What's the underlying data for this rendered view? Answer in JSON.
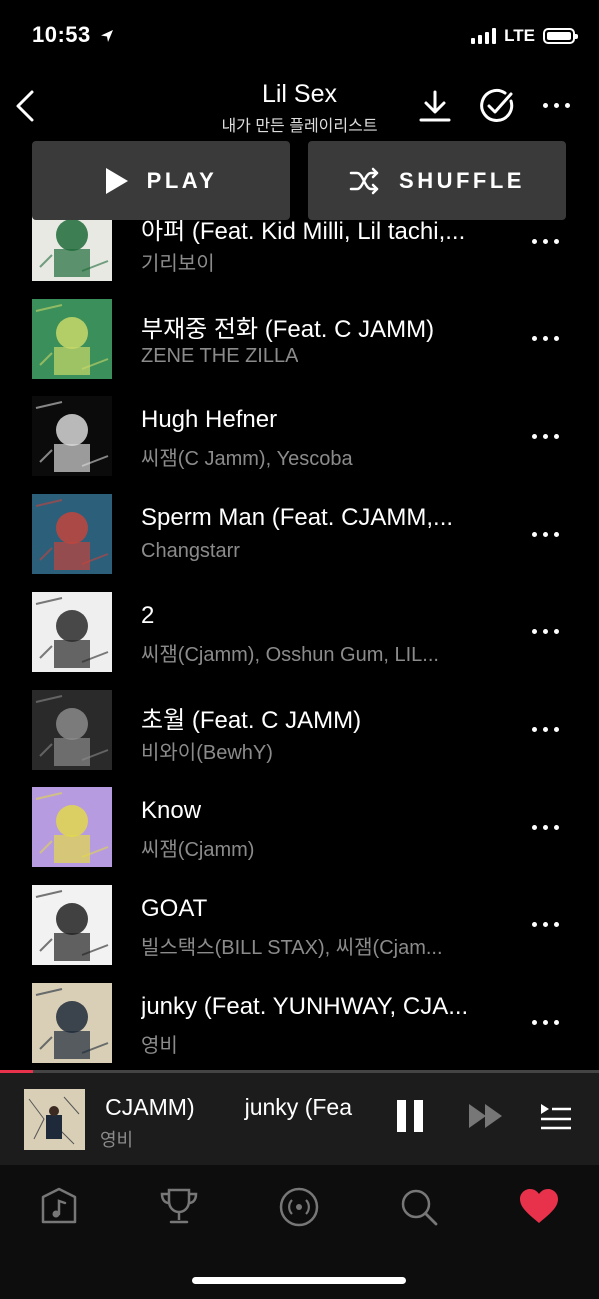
{
  "status": {
    "time": "10:53",
    "network": "LTE"
  },
  "header": {
    "title": "Lil Sex",
    "subtitle": "내가 만든 플레이리스트"
  },
  "actions": {
    "play_label": "PLAY",
    "shuffle_label": "SHUFFLE"
  },
  "tracks": [
    {
      "title": "아퍼 (Feat. Kid Milli, Lil tachi,...",
      "artist": "기리보이",
      "art_colors": [
        "#e9e9e3",
        "#1f6b3a"
      ]
    },
    {
      "title": "부재중 전화 (Feat. C JAMM)",
      "artist": "ZENE THE ZILLA",
      "art_colors": [
        "#3b8f5a",
        "#c9d86a"
      ]
    },
    {
      "title": "Hugh Hefner",
      "artist": "씨잼(C Jamm), Yescoba",
      "art_colors": [
        "#0b0b0b",
        "#d8d8d8"
      ]
    },
    {
      "title": "Sperm Man (Feat. CJAMM,...",
      "artist": "Changstarr",
      "art_colors": [
        "#2c5f7a",
        "#c2453d"
      ]
    },
    {
      "title": "2",
      "artist": "씨잼(Cjamm), Osshun Gum, LIL...",
      "art_colors": [
        "#efefef",
        "#2a2a2a"
      ]
    },
    {
      "title": "초월 (Feat. C JAMM)",
      "artist": "비와이(BewhY)",
      "art_colors": [
        "#2a2a2a",
        "#8a8a8a"
      ]
    },
    {
      "title": "Know",
      "artist": "씨잼(Cjamm)",
      "art_colors": [
        "#b79be0",
        "#e2d84c"
      ]
    },
    {
      "title": "GOAT",
      "artist": "빌스택스(BILL STAX), 씨잼(Cjam...",
      "art_colors": [
        "#f2f2f2",
        "#222222"
      ]
    },
    {
      "title": "junky (Feat. YUNHWAY, CJA...",
      "artist": "영비",
      "art_colors": [
        "#d9cfb6",
        "#1e2a3a"
      ]
    }
  ],
  "now_playing": {
    "title_scroll_a": ", CJAMM)",
    "title_scroll_b": "junky (Fea",
    "artist": "영비",
    "progress": 0.055
  },
  "tabs": [
    "library",
    "charts",
    "radio",
    "search",
    "favorites"
  ],
  "colors": {
    "accent": "#e8314b",
    "background": "#000000",
    "button_bg": "#3a3a3a"
  }
}
